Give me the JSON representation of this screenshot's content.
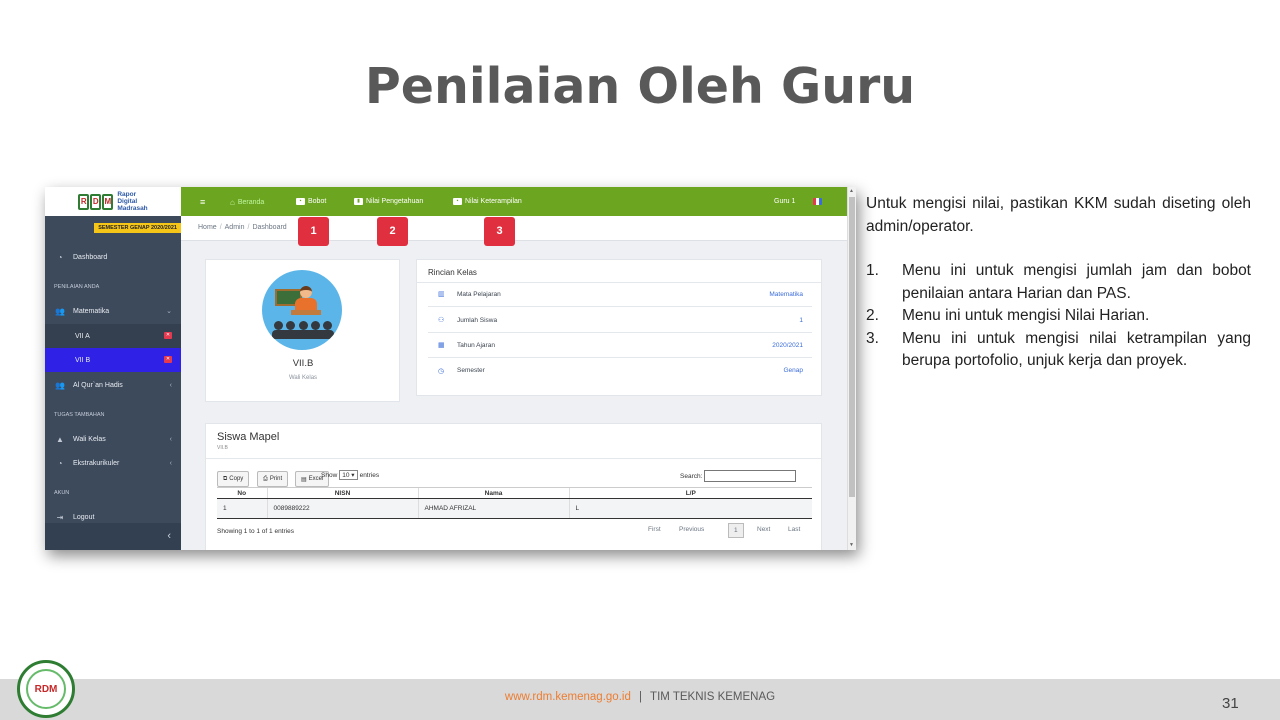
{
  "slide": {
    "title": "Penilaian Oleh Guru",
    "page_number": "31",
    "footer_url": "www.rdm.kemenag.go.id",
    "footer_sep": "|",
    "footer_team": "TIM TEKNIS KEMENAG",
    "logo_text": "RDM"
  },
  "app": {
    "logo_letters": [
      "R",
      "D",
      "M"
    ],
    "logo_text": [
      "Rapor",
      "Digital",
      "Madrasah"
    ],
    "semester_badge": "SEMESTER GENAP 2020/2021",
    "topbar": {
      "beranda": "Beranda",
      "bobot": "Bobot",
      "nilai_pengetahuan": "Nilai Pengetahuan",
      "nilai_keterampilan": "Nilai Keterampilan",
      "user": "Guru 1"
    },
    "breadcrumb": [
      "Home",
      "Admin",
      "Dashboard"
    ],
    "markers": [
      "1",
      "2",
      "3"
    ],
    "sidebar": {
      "dashboard": "Dashboard",
      "head_penilaian": "PENILAIAN ANDA",
      "matematika": "Matematika",
      "vii_a": "VII A",
      "vii_b": "VII B",
      "alquran": "Al Qur`an Hadis",
      "head_tugas": "TUGAS TAMBAHAN",
      "wali_kelas": "Wali Kelas",
      "ekstrakurikuler": "Ekstrakurikuler",
      "head_akun": "AKUN",
      "logout": "Logout"
    },
    "kelas_card": {
      "name": "VII.B",
      "role": "Wali Kelas"
    },
    "rincian": {
      "title": "Rincian Kelas",
      "rows": [
        {
          "label": "Mata Pelajaran",
          "value": "Matematika",
          "icon": "book-icon"
        },
        {
          "label": "Jumlah Siswa",
          "value": "1",
          "icon": "users-icon"
        },
        {
          "label": "Tahun Ajaran",
          "value": "2020/2021",
          "icon": "calendar-icon"
        },
        {
          "label": "Semester",
          "value": "Genap",
          "icon": "clock-icon"
        }
      ]
    },
    "siswa": {
      "title": "Siswa Mapel",
      "subtitle": "VII.B",
      "btn_copy": "Copy",
      "btn_print": "Print",
      "btn_excel": "Excel",
      "show_label": "Show",
      "show_value": "10",
      "entries_label": "entries",
      "search_label": "Search:",
      "columns": [
        "No",
        "NISN",
        "Nama",
        "L/P"
      ],
      "rows": [
        [
          "1",
          "0089889222",
          "AHMAD AFRIZAL",
          "L"
        ]
      ],
      "info": "Showing 1 to 1 of 1 entries",
      "pagination": {
        "first": "First",
        "previous": "Previous",
        "current": "1",
        "next": "Next",
        "last": "Last"
      }
    }
  },
  "description": {
    "intro": "Untuk mengisi nilai, pastikan KKM sudah diseting oleh admin/operator.",
    "items": [
      {
        "num": "1.",
        "text": "Menu ini untuk mengisi jumlah jam dan bobot penilaian antara Harian dan PAS."
      },
      {
        "num": "2.",
        "text": "Menu ini untuk mengisi Nilai Harian."
      },
      {
        "num": "3.",
        "text": "Menu ini untuk mengisi nilai ketrampilan yang berupa portofolio, unjuk kerja dan proyek."
      }
    ]
  },
  "colors": {
    "topbar": "#6ca520",
    "sidebar": "#3d4a5c",
    "active_item": "#2f22e6",
    "marker": "#e0303f",
    "footer_url": "#ed7d31"
  }
}
